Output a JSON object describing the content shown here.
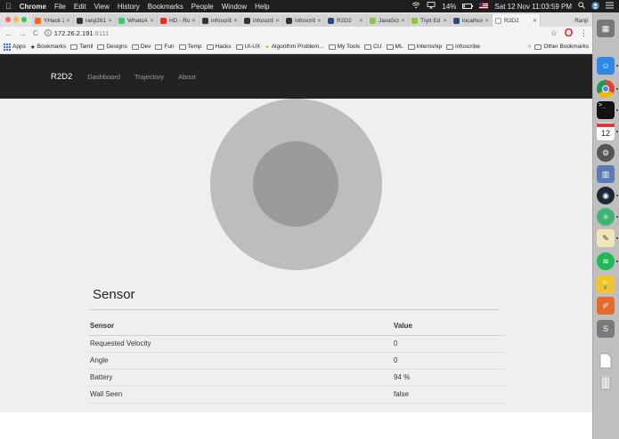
{
  "menubar": {
    "apple": "",
    "app": "Chrome",
    "items": [
      "File",
      "Edit",
      "View",
      "History",
      "Bookmarks",
      "People",
      "Window",
      "Help"
    ],
    "battery": "14%",
    "datetime": "Sat 12 Nov  11:03:59 PM"
  },
  "tabs": [
    {
      "label": "YHack 2",
      "color": "#ff6600"
    },
    {
      "label": "ranji261",
      "color": "#333333"
    },
    {
      "label": "WhatsAp",
      "color": "#25d366"
    },
    {
      "label": "HD - Ro",
      "color": "#e52d27"
    },
    {
      "label": "infoscrib",
      "color": "#333333"
    },
    {
      "label": "infoscrib",
      "color": "#333333"
    },
    {
      "label": "infoscrib",
      "color": "#333333"
    },
    {
      "label": "R2D2",
      "color": "#2b4a7a"
    },
    {
      "label": "JavaScr",
      "color": "#8dc63f"
    },
    {
      "label": "Tryit Ed",
      "color": "#8dc63f"
    },
    {
      "label": "localhos",
      "color": "#2b4a7a"
    },
    {
      "label": "R2D2",
      "color": "#ffffff",
      "active": true
    }
  ],
  "profile": "Ranji",
  "toolbar": {
    "back": "←",
    "forward": "→",
    "reload": "C",
    "url_host": "172.26.2.191",
    "url_port": ":8111",
    "star": "☆",
    "menu": "⋮"
  },
  "bookmarks": {
    "apps": "Apps",
    "items": [
      "Bookmarks",
      "Tamil",
      "Designs",
      "Dev",
      "Fun",
      "Temp",
      "Hacks",
      "UI-UX",
      "Algorithm Problem...",
      "My Tools",
      "CU",
      "ML",
      "Internship",
      "infoscribe"
    ],
    "other": "Other Bookmarks"
  },
  "page": {
    "brand": "R2D2",
    "nav": [
      "Dashboard",
      "Trajectory",
      "About"
    ],
    "sensor_heading": "Sensor",
    "table": {
      "headers": [
        "Sensor",
        "Value"
      ],
      "rows": [
        [
          "Requested Velocity",
          "0"
        ],
        [
          "Angle",
          "0"
        ],
        [
          "Battery",
          "94 %"
        ],
        [
          "Wall Seen",
          "false"
        ]
      ]
    }
  },
  "dock": {
    "calendar_day": "12"
  }
}
